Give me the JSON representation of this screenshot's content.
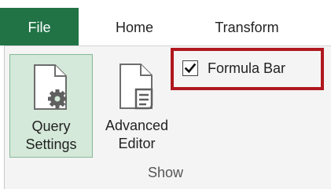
{
  "tabs": {
    "file": "File",
    "home": "Home",
    "transform": "Transform"
  },
  "show_group": {
    "label": "Show",
    "query_settings": {
      "line1": "Query",
      "line2": "Settings",
      "pressed": true
    },
    "advanced_editor": {
      "line1": "Advanced",
      "line2": "Editor"
    },
    "formula_bar": {
      "label": "Formula Bar",
      "checked": true
    }
  },
  "colors": {
    "file_tab": "#217346",
    "highlight_border": "#b0171f",
    "pressed_button_bg": "#d4e9d9",
    "ribbon_bg": "#f4f4f4"
  },
  "icons": {
    "query_settings": "document-gear-icon",
    "advanced_editor": "document-scroll-icon",
    "formula_bar_check": "checkmark-icon"
  }
}
